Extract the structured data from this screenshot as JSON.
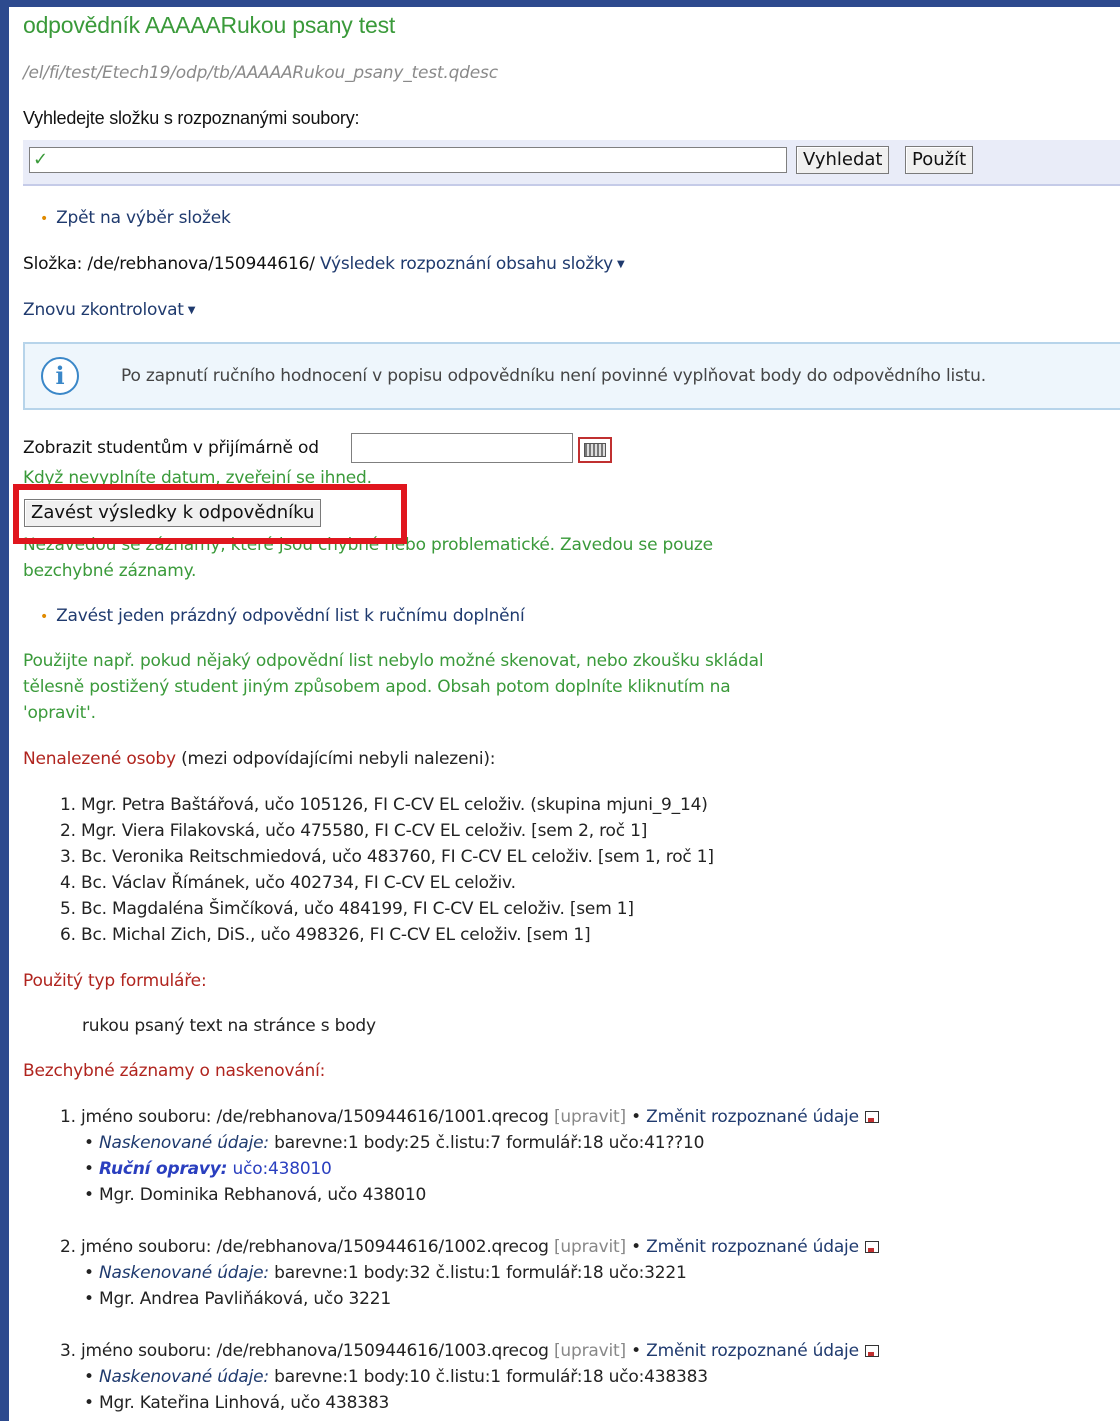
{
  "page": {
    "title": "odpovědník AAAAARukou psany test",
    "path": "/el/fi/test/Etech19/odp/tb/AAAAARukou_psany_test.qdesc"
  },
  "search": {
    "label": "Vyhledejte složku s rozpoznanými soubory:",
    "value": "",
    "search_button": "Vyhledat",
    "use_button": "Použít"
  },
  "back_link": "Zpět na výběr složek",
  "folder": {
    "label": "Složka:",
    "path": "/de/rebhanova/150944616/",
    "result_menu": "Výsledek rozpoznání obsahu složky"
  },
  "recheck_menu": "Znovu zkontrolovat",
  "info": {
    "text": "Po zapnutí ručního hodnocení v popisu odpovědníku není povinné vyplňovat body do odpovědního listu."
  },
  "publish": {
    "label": "Zobrazit studentům v přijímárně od",
    "date_value": "",
    "hint": "Když nevyplníte datum, zveřejní se ihned."
  },
  "import_button": "Zavést výsledky k odpovědníku",
  "import_note_line1": "Nezavedou se záznamy, které jsou chybné nebo problematické. Zavedou se pouze",
  "import_note_line2": "bezchybné záznamy.",
  "empty_sheet_link": "Zavést jeden prázdný odpovědní list k ručnímu doplnění",
  "empty_sheet_note": [
    "Použijte např. pokud nějaký odpovědní list nebylo možné skenovat, nebo zkoušku skládal",
    "tělesně postižený student jiným způsobem apod. Obsah potom doplníte kliknutím na",
    "'opravit'."
  ],
  "not_found": {
    "heading": "Nenalezené osoby",
    "heading_suffix": "(mezi odpovídajícími nebyli nalezeni):",
    "items": [
      "1. Mgr. Petra Baštářová, učo 105126, FI C-CV EL celoživ. (skupina mjuni_9_14)",
      "2. Mgr. Viera Filakovská, učo 475580, FI C-CV EL celoživ. [sem 2, roč 1]",
      "3. Bc. Veronika Reitschmiedová, učo 483760, FI C-CV EL celoživ. [sem 1, roč 1]",
      "4. Bc. Václav Římánek, učo 402734, FI C-CV EL celoživ.",
      "5. Bc. Magdaléna Šimčíková, učo 484199, FI C-CV EL celoživ. [sem 1]",
      "6. Bc. Michal Zich, DiS., učo 498326, FI C-CV EL celoživ. [sem 1]"
    ]
  },
  "form_type": {
    "heading": "Použitý typ formuláře:",
    "value": "rukou psaný text na stránce s body"
  },
  "records": {
    "heading": "Bezchybné záznamy o naskenování:",
    "items": [
      {
        "num_file": "1. jméno souboru: /de/rebhanova/150944616/1001.qrecog",
        "edit": "[upravit]",
        "change": "Změnit rozpoznané údaje",
        "scanned_label": "Naskenované údaje:",
        "scanned": "barevne:1 body:25 č.listu:7 formulář:18 učo:41??10",
        "manual_label": "Ruční opravy:",
        "manual": "učo:438010",
        "person": "Mgr. Dominika Rebhanová, učo 438010"
      },
      {
        "num_file": "2. jméno souboru: /de/rebhanova/150944616/1002.qrecog",
        "edit": "[upravit]",
        "change": "Změnit rozpoznané údaje",
        "scanned_label": "Naskenované údaje:",
        "scanned": "barevne:1 body:32 č.listu:1 formulář:18 učo:3221",
        "person": "Mgr. Andrea Pavliňáková, učo 3221"
      },
      {
        "num_file": "3. jméno souboru: /de/rebhanova/150944616/1003.qrecog",
        "edit": "[upravit]",
        "change": "Změnit rozpoznané údaje",
        "scanned_label": "Naskenované údaje:",
        "scanned": "barevne:1 body:10 č.listu:1 formulář:18 učo:438383",
        "person": "Mgr. Kateřina Linhová, učo 438383"
      }
    ]
  },
  "colors": {
    "frame": "#2d4a8e",
    "green_text": "#3a9a3a",
    "red_heading": "#b0241e",
    "highlight_box": "#e0161e"
  }
}
